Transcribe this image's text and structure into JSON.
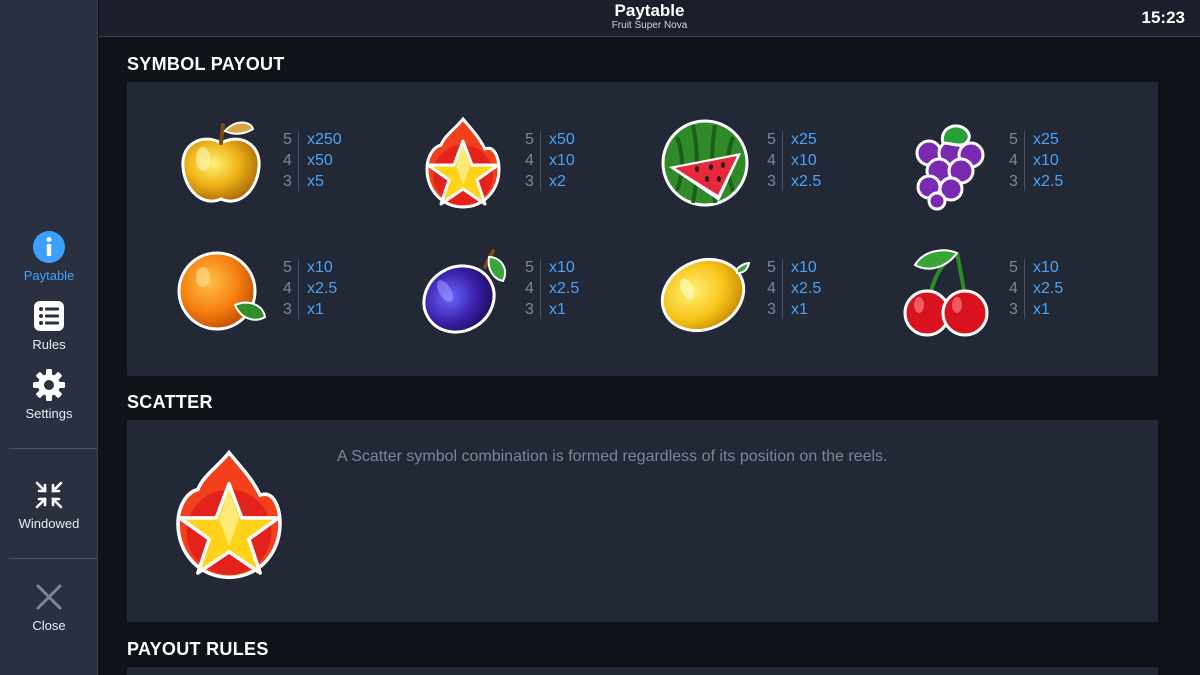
{
  "header": {
    "title": "Paytable",
    "subtitle": "Fruit Super Nova",
    "clock": "15:23"
  },
  "sidebar": {
    "items": [
      {
        "label": "Paytable",
        "icon": "info-icon",
        "active": true
      },
      {
        "label": "Rules",
        "icon": "list-icon",
        "active": false
      },
      {
        "label": "Settings",
        "icon": "gear-icon",
        "active": false
      },
      {
        "label": "Windowed",
        "icon": "shrink-icon",
        "active": false
      },
      {
        "label": "Close",
        "icon": "close-icon",
        "active": false
      }
    ]
  },
  "sections": {
    "symbol_payout": "SYMBOL PAYOUT",
    "scatter": "SCATTER",
    "payout_rules": "PAYOUT RULES"
  },
  "symbols": [
    {
      "icon": "golden-apple-icon",
      "payouts": [
        {
          "count": "5",
          "mult": "x250"
        },
        {
          "count": "4",
          "mult": "x50"
        },
        {
          "count": "3",
          "mult": "x5"
        }
      ]
    },
    {
      "icon": "fire-star-icon",
      "payouts": [
        {
          "count": "5",
          "mult": "x50"
        },
        {
          "count": "4",
          "mult": "x10"
        },
        {
          "count": "3",
          "mult": "x2"
        }
      ]
    },
    {
      "icon": "watermelon-icon",
      "payouts": [
        {
          "count": "5",
          "mult": "x25"
        },
        {
          "count": "4",
          "mult": "x10"
        },
        {
          "count": "3",
          "mult": "x2.5"
        }
      ]
    },
    {
      "icon": "grapes-icon",
      "payouts": [
        {
          "count": "5",
          "mult": "x25"
        },
        {
          "count": "4",
          "mult": "x10"
        },
        {
          "count": "3",
          "mult": "x2.5"
        }
      ]
    },
    {
      "icon": "orange-icon",
      "payouts": [
        {
          "count": "5",
          "mult": "x10"
        },
        {
          "count": "4",
          "mult": "x2.5"
        },
        {
          "count": "3",
          "mult": "x1"
        }
      ]
    },
    {
      "icon": "plum-icon",
      "payouts": [
        {
          "count": "5",
          "mult": "x10"
        },
        {
          "count": "4",
          "mult": "x2.5"
        },
        {
          "count": "3",
          "mult": "x1"
        }
      ]
    },
    {
      "icon": "lemon-icon",
      "payouts": [
        {
          "count": "5",
          "mult": "x10"
        },
        {
          "count": "4",
          "mult": "x2.5"
        },
        {
          "count": "3",
          "mult": "x1"
        }
      ]
    },
    {
      "icon": "cherries-icon",
      "payouts": [
        {
          "count": "5",
          "mult": "x10"
        },
        {
          "count": "4",
          "mult": "x2.5"
        },
        {
          "count": "3",
          "mult": "x1"
        }
      ]
    }
  ],
  "scatter": {
    "icon": "scatter-fire-star-icon",
    "description": "A Scatter symbol combination is formed regardless of its position on the reels."
  },
  "colors": {
    "accent": "#3da0ff",
    "multiplier": "#4aa3f7",
    "panel": "#232836",
    "sidebar": "#2a3040"
  }
}
